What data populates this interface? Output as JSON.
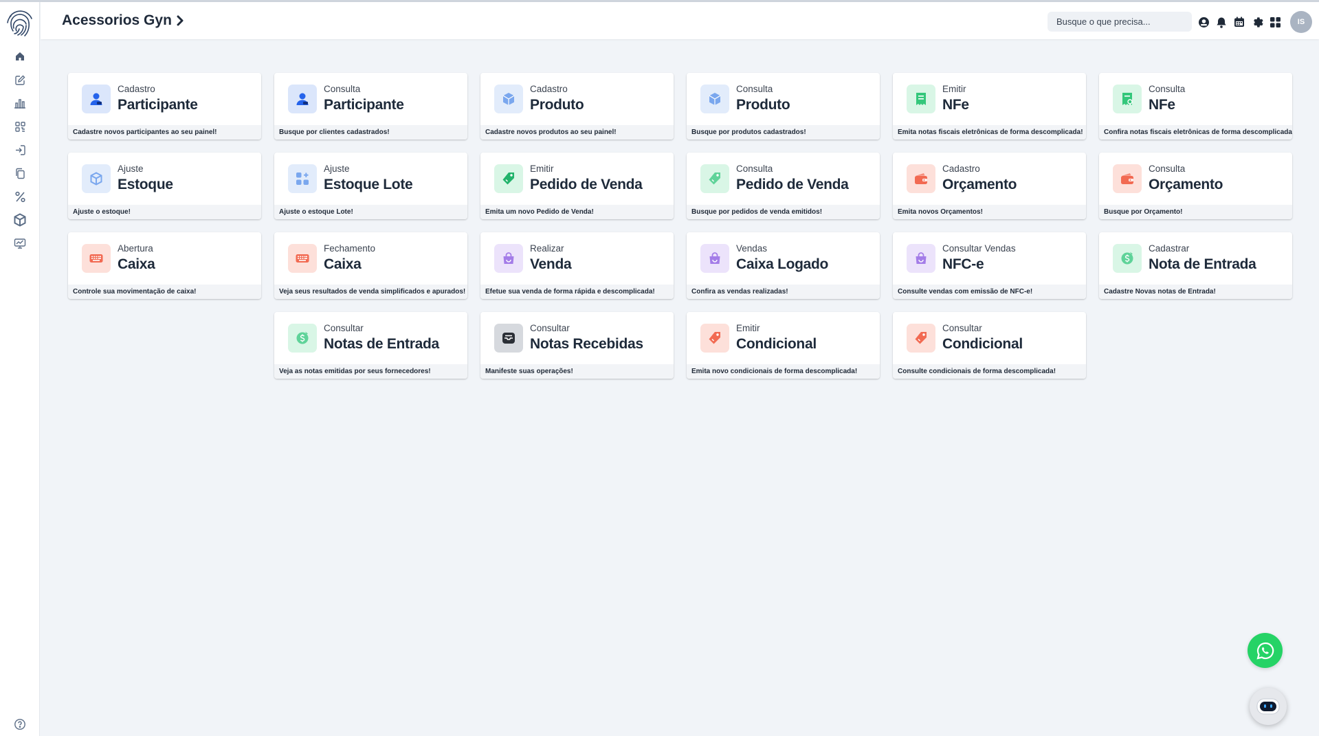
{
  "header": {
    "title": "Acessorios Gyn",
    "search_placeholder": "Busque o que precisa...",
    "avatar_initials": "IS"
  },
  "sidebar": {
    "items": [
      "home-icon",
      "edit-icon",
      "chart-bars-icon",
      "qr-scan-icon",
      "login-icon",
      "copy-icon",
      "percent-icon",
      "box-icon",
      "monitor-chart-icon"
    ],
    "bottom": "help-icon"
  },
  "cards": [
    {
      "name": "cadastro-participante",
      "sub": "Cadastro",
      "main": "Participante",
      "desc": "Cadastre novos participantes ao seu painel!",
      "icon": "user-icon",
      "tint": "#dbe6fb",
      "color": "#2563eb"
    },
    {
      "name": "consulta-participante",
      "sub": "Consulta",
      "main": "Participante",
      "desc": "Busque por clientes cadastrados!",
      "icon": "user-icon",
      "tint": "#dbe6fb",
      "color": "#2563eb"
    },
    {
      "name": "cadastro-produto",
      "sub": "Cadastro",
      "main": "Produto",
      "desc": "Cadastre novos produtos ao seu painel!",
      "icon": "cube-icon",
      "tint": "#e2ecfb",
      "color": "#7aa7ee"
    },
    {
      "name": "consulta-produto",
      "sub": "Consulta",
      "main": "Produto",
      "desc": "Busque por produtos cadastrados!",
      "icon": "cube-icon",
      "tint": "#e2ecfb",
      "color": "#7aa7ee"
    },
    {
      "name": "emitir-nfe",
      "sub": "Emitir",
      "main": "NFe",
      "desc": "Emita notas fiscais eletrônicas de forma descomplicada!",
      "icon": "receipt-icon",
      "tint": "#d9f6e6",
      "color": "#34c77b"
    },
    {
      "name": "consulta-nfe",
      "sub": "Consulta",
      "main": "NFe",
      "desc": "Confira notas fiscais eletrônicas de forma descomplicada!",
      "icon": "receipt-search-icon",
      "tint": "#d9f6e6",
      "color": "#34c77b"
    },
    {
      "name": "ajuste-estoque",
      "sub": "Ajuste",
      "main": "Estoque",
      "desc": "Ajuste o estoque!",
      "icon": "box-icon",
      "tint": "#e2ecfb",
      "color": "#7aa7ee"
    },
    {
      "name": "ajuste-estoque-lote",
      "sub": "Ajuste",
      "main": "Estoque Lote",
      "desc": "Ajuste o estoque Lote!",
      "icon": "grid-plus-icon",
      "tint": "#e2ecfb",
      "color": "#7aa7ee"
    },
    {
      "name": "emitir-pedido-venda",
      "sub": "Emitir",
      "main": "Pedido de Venda",
      "desc": "Emita um novo Pedido de Venda!",
      "icon": "tag-icon",
      "tint": "#d9f6e6",
      "color": "#22b36b"
    },
    {
      "name": "consulta-pedido-venda",
      "sub": "Consulta",
      "main": "Pedido de Venda",
      "desc": "Busque por pedidos de venda emitidos!",
      "icon": "tag-icon",
      "tint": "#d9f6e6",
      "color": "#5fd399"
    },
    {
      "name": "cadastro-orcamento",
      "sub": "Cadastro",
      "main": "Orçamento",
      "desc": "Emita novos Orçamentos!",
      "icon": "wallet-icon",
      "tint": "#fde0da",
      "color": "#f26a52"
    },
    {
      "name": "consulta-orcamento",
      "sub": "Consulta",
      "main": "Orçamento",
      "desc": "Busque por Orçamento!",
      "icon": "wallet-icon",
      "tint": "#fde0da",
      "color": "#f26a52"
    },
    {
      "name": "abertura-caixa",
      "sub": "Abertura",
      "main": "Caixa",
      "desc": "Controle sua movimentação de caixa!",
      "icon": "keyboard-icon",
      "tint": "#fde0da",
      "color": "#f26a52"
    },
    {
      "name": "fechamento-caixa",
      "sub": "Fechamento",
      "main": "Caixa",
      "desc": "Veja seus resultados de venda simplificados e apurados!",
      "icon": "keyboard-icon",
      "tint": "#fde0da",
      "color": "#f26a52"
    },
    {
      "name": "realizar-venda",
      "sub": "Realizar",
      "main": "Venda",
      "desc": "Efetue sua venda de forma rápida e descomplicada!",
      "icon": "bag-icon",
      "tint": "#ece3fb",
      "color": "#a47de8"
    },
    {
      "name": "vendas-caixa-logado",
      "sub": "Vendas",
      "main": "Caixa Logado",
      "desc": "Confira as vendas realizadas!",
      "icon": "bag-icon",
      "tint": "#ece3fb",
      "color": "#a47de8"
    },
    {
      "name": "consultar-vendas-nfce",
      "sub": "Consultar Vendas",
      "main": "NFC-e",
      "desc": "Consulte vendas com emissão de NFC-e!",
      "icon": "bag-icon",
      "tint": "#ece3fb",
      "color": "#a47de8"
    },
    {
      "name": "cadastrar-nota-entrada",
      "sub": "Cadastrar",
      "main": "Nota de Entrada",
      "desc": "Cadastre Novas notas de Entrada!",
      "icon": "coin-icon",
      "tint": "#d9f6e6",
      "color": "#5fd399"
    },
    {
      "name": "consultar-notas-entrada",
      "sub": "Consultar",
      "main": "Notas de Entrada",
      "desc": "Veja as notas emitidas por seus fornecedores!",
      "icon": "coin-icon",
      "tint": "#d9f6e6",
      "color": "#5fd399"
    },
    {
      "name": "consultar-notas-recebidas",
      "sub": "Consultar",
      "main": "Notas Recebidas",
      "desc": "Manifeste suas operações!",
      "icon": "inbox-icon",
      "tint": "#d6d9de",
      "color": "#2b2f36"
    },
    {
      "name": "emitir-condicional",
      "sub": "Emitir",
      "main": "Condicional",
      "desc": "Emita novo condicionais de forma descomplicada!",
      "icon": "tag-icon",
      "tint": "#fde0da",
      "color": "#f26a52"
    },
    {
      "name": "consultar-condicional",
      "sub": "Consultar",
      "main": "Condicional",
      "desc": "Consulte condicionais de forma descomplicada!",
      "icon": "tag-icon",
      "tint": "#fde0da",
      "color": "#f26a52"
    }
  ],
  "floating": {
    "whatsapp": "whatsapp-icon",
    "assistant": "robot-icon"
  }
}
